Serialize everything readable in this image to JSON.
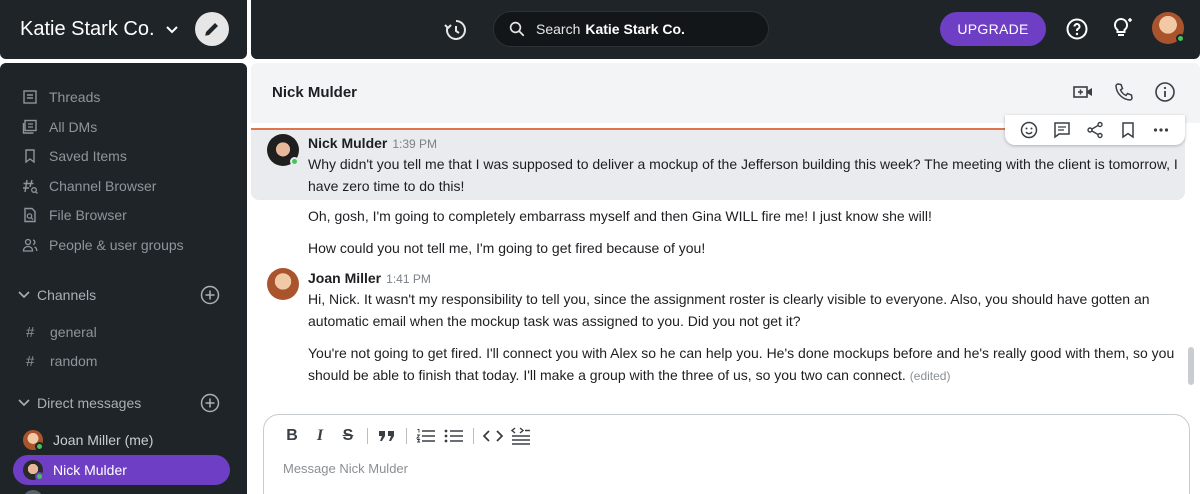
{
  "workspace": {
    "name": "Katie Stark Co."
  },
  "topbar": {
    "search_placeholder": "Search",
    "search_scope": "Katie Stark Co.",
    "upgrade_label": "UPGRADE"
  },
  "sidebar": {
    "nav": [
      {
        "label": "Threads",
        "icon": "threads-icon"
      },
      {
        "label": "All DMs",
        "icon": "all-dms-icon"
      },
      {
        "label": "Saved Items",
        "icon": "bookmark-icon"
      },
      {
        "label": "Channel Browser",
        "icon": "channel-browser-icon"
      },
      {
        "label": "File Browser",
        "icon": "file-search-icon"
      },
      {
        "label": "People & user groups",
        "icon": "people-icon"
      }
    ],
    "channels_label": "Channels",
    "channels": [
      {
        "name": "general"
      },
      {
        "name": "random"
      }
    ],
    "dms_label": "Direct messages",
    "dms": [
      {
        "name": "Joan Miller (me)",
        "active": false
      },
      {
        "name": "Nick Mulder",
        "active": true
      }
    ]
  },
  "chat": {
    "title": "Nick Mulder",
    "messages": [
      {
        "author": "Nick Mulder",
        "time": "1:39 PM",
        "paragraphs": [
          "Why didn't you tell me that I was supposed to deliver a mockup of the Jefferson building this week? The meeting with the client is tomorrow, I have zero time to do this!",
          "Oh, gosh, I'm going to completely embarrass myself and then Gina WILL fire me! I just know she will!",
          "How could you not tell me, I'm going to get fired because of you!"
        ]
      },
      {
        "author": "Joan Miller",
        "time": "1:41 PM",
        "paragraphs": [
          "Hi, Nick. It wasn't my responsibility to tell you, since the assignment roster is clearly visible to everyone. Also, you should have gotten an automatic email when the mockup task was assigned to you. Did you not get it?",
          "You're not going to get fired. I'll connect you with Alex so he can help you. He's done mockups before and he's really good with them, so you should be able to finish that today. I'll make a group with the three of us, so you two can connect."
        ],
        "edited_label": "(edited)"
      }
    ]
  },
  "composer": {
    "placeholder": "Message Nick Mulder"
  },
  "colors": {
    "accent": "#6e3fc5",
    "sidebar_bg": "#1f2429",
    "online": "#46c45b",
    "highlight_border": "#e0744c"
  }
}
